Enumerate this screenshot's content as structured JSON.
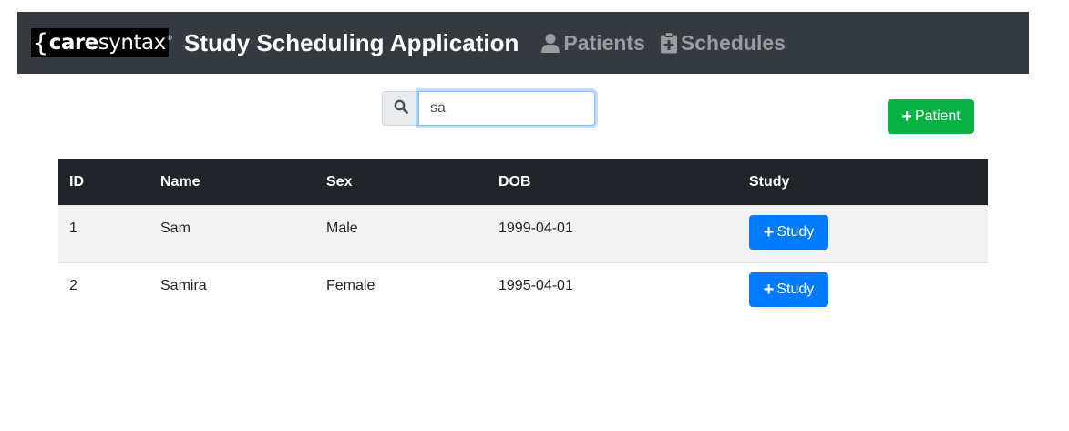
{
  "header": {
    "logo_brace": "{",
    "logo_care": "care",
    "logo_syntax": "syntax",
    "logo_reg": "®",
    "title": "Study Scheduling Application",
    "nav": [
      {
        "label": "Patients",
        "icon": "user-icon"
      },
      {
        "label": "Schedules",
        "icon": "clipboard-plus-icon"
      }
    ],
    "bg_color": "#343a40"
  },
  "search": {
    "value": "sa",
    "placeholder": "",
    "icon": "search-icon"
  },
  "add_patient_button": {
    "plus": "+",
    "label": "Patient",
    "color": "#0ab144"
  },
  "table": {
    "columns": [
      "ID",
      "Name",
      "Sex",
      "DOB",
      "Study"
    ],
    "rows": [
      {
        "id": "1",
        "name": "Sam",
        "sex": "Male",
        "dob": "1999-04-01",
        "study_plus": "+",
        "study_label": "Study"
      },
      {
        "id": "2",
        "name": "Samira",
        "sex": "Female",
        "dob": "1995-04-01",
        "study_plus": "+",
        "study_label": "Study"
      }
    ],
    "study_button_color": "#007bff"
  }
}
